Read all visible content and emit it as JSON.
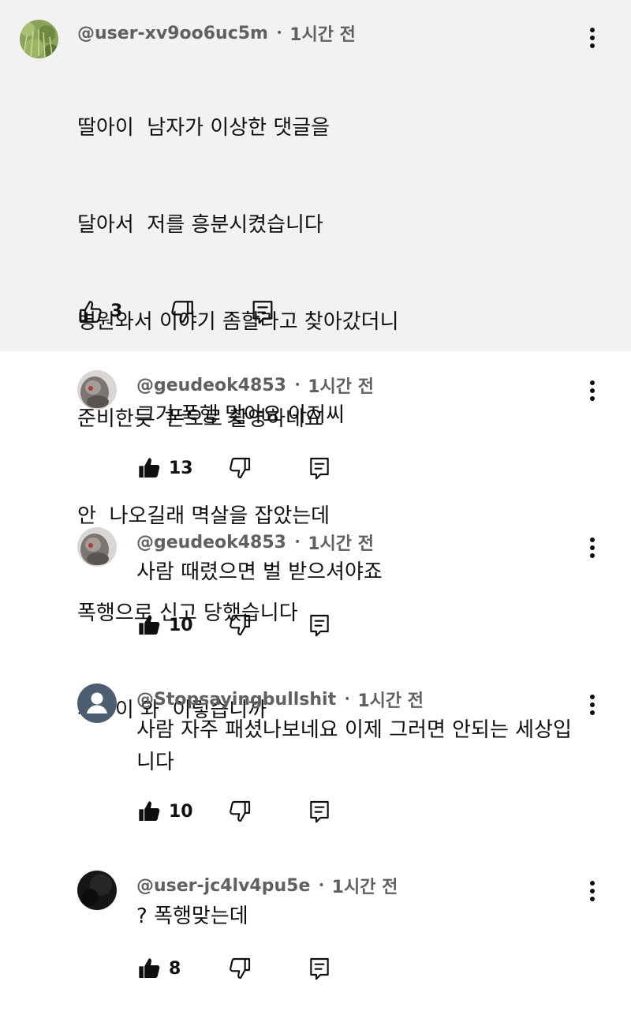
{
  "parent": {
    "handle": "@user-xv9oo6uc5m",
    "time": "1시간 전",
    "lines": [
      "딸아이  남자가 이상한 댓글을",
      "달아서  저를 흥분시켰습니다",
      "병원와서 이야기 좀할라고 찾아갔더니",
      "준비한듯  폰으로 촬영하네요",
      "안  나오길래 멱살을 잡았는데",
      "폭행으로 신고 당했습니다",
      "세상이 와  이렇습니까"
    ],
    "likes": "3"
  },
  "replies": [
    {
      "handle": "@geudeok4853",
      "time": "1시간 전",
      "text": "그거 폭행 맞아요 아저씨",
      "likes": "13"
    },
    {
      "handle": "@geudeok4853",
      "time": "1시간 전",
      "text": "사람 때렸으면 벌 받으셔야죠",
      "likes": "10"
    },
    {
      "handle": "@Stopsayingbullshit",
      "time": "1시간 전",
      "text": "사람 자주 패셨나보네요 이제 그러면 안되는 세상입\n니다",
      "likes": "10"
    },
    {
      "handle": "@user-jc4lv4pu5e",
      "time": "1시간 전",
      "text": "? 폭행맞는데",
      "likes": "8"
    }
  ],
  "icons": {
    "like": "thumbs-up-icon",
    "dislike": "thumbs-down-icon",
    "reply": "reply-comment-icon",
    "more": "more-vert-icon"
  },
  "colors": {
    "parent_background": "#f2f2f2",
    "meta_text": "#606060",
    "body_text": "#0f0f0f",
    "default_avatar": "#4d5e70"
  }
}
